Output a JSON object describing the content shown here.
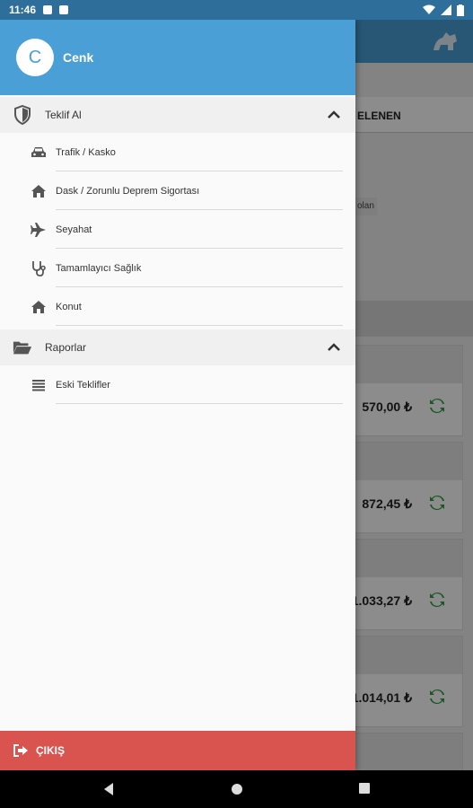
{
  "status_bar": {
    "time": "11:46"
  },
  "drawer": {
    "user": {
      "initial": "C",
      "name": "Cenk"
    },
    "groups": [
      {
        "label": "Teklif Al",
        "icon": "shield-icon",
        "expanded": true,
        "items": [
          {
            "label": "Trafik / Kasko",
            "icon": "car-icon"
          },
          {
            "label": "Dask / Zorunlu Deprem Sigortası",
            "icon": "home-icon"
          },
          {
            "label": "Seyahat",
            "icon": "airplane-icon"
          },
          {
            "label": "Tamamlayıcı Sağlık",
            "icon": "stethoscope-icon"
          },
          {
            "label": "Konut",
            "icon": "home-icon"
          }
        ]
      },
      {
        "label": "Raporlar",
        "icon": "folder-open-icon",
        "expanded": true,
        "items": [
          {
            "label": "Eski Teklifler",
            "icon": "list-icon"
          }
        ]
      }
    ],
    "logout_label": "ÇIKIŞ"
  },
  "background": {
    "tab_label_partial": "ELENEN",
    "chip_partial": "olan",
    "prices": [
      "570,00 ₺",
      "872,45 ₺",
      "1.033,27 ₺",
      "1.014,01 ₺"
    ]
  },
  "colors": {
    "primary": "#4a9fd6",
    "logout": "#d9534f",
    "refresh": "#2e9e3f"
  }
}
